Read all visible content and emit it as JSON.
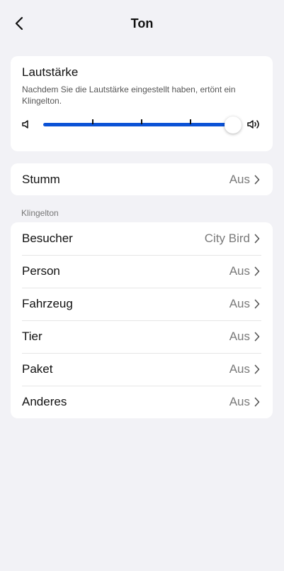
{
  "header": {
    "title": "Ton"
  },
  "volume": {
    "title": "Lautstärke",
    "description": "Nachdem Sie die Lautstärke eingestellt haben, ertönt ein Klingelton.",
    "level": 1.0,
    "accent_color": "#0b52d6"
  },
  "mute": {
    "label": "Stumm",
    "value": "Aus"
  },
  "ringtone": {
    "section_label": "Klingelton",
    "items": [
      {
        "label": "Besucher",
        "value": "City Bird"
      },
      {
        "label": "Person",
        "value": "Aus"
      },
      {
        "label": "Fahrzeug",
        "value": "Aus"
      },
      {
        "label": "Tier",
        "value": "Aus"
      },
      {
        "label": "Paket",
        "value": "Aus"
      },
      {
        "label": "Anderes",
        "value": "Aus"
      }
    ]
  },
  "icons": {
    "back": "chevron-left-icon",
    "volume_low": "speaker-low-icon",
    "volume_high": "speaker-high-icon",
    "row_arrow": "chevron-right-icon"
  }
}
